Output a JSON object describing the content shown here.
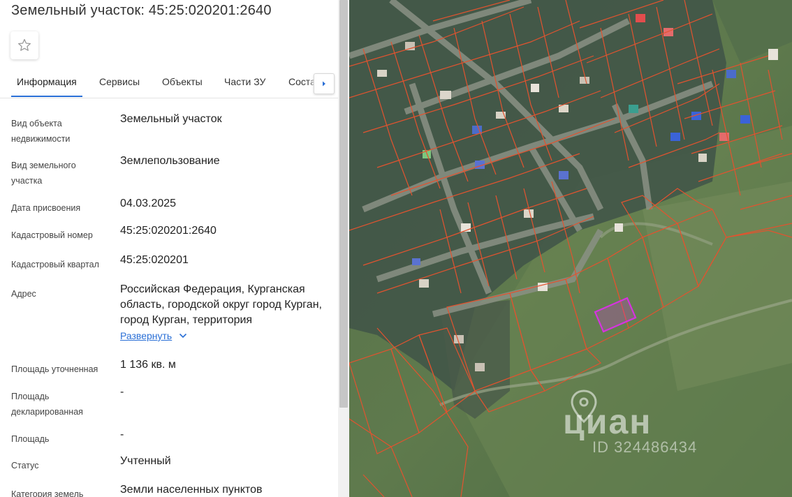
{
  "header": {
    "title": "Земельный участок: 45:25:020201:2640"
  },
  "tabs": [
    {
      "label": "Информация"
    },
    {
      "label": "Сервисы"
    },
    {
      "label": "Объекты"
    },
    {
      "label": "Части ЗУ"
    },
    {
      "label": "Состав"
    }
  ],
  "info": {
    "object_type": {
      "label": "Вид объекта недвижимости",
      "value": "Земельный участок"
    },
    "parcel_type": {
      "label": "Вид земельного участка",
      "value": "Землепользование"
    },
    "assign_date": {
      "label": "Дата присвоения",
      "value": "04.03.2025"
    },
    "cadastral_number": {
      "label": "Кадастровый номер",
      "value": "45:25:020201:2640"
    },
    "cadastral_quarter": {
      "label": "Кадастровый квартал",
      "value": "45:25:020201"
    },
    "address": {
      "label": "Адрес",
      "value": "Российская Федерация, Курганская область, городской округ город Курган, город Курган, территория",
      "expand_label": "Развернуть"
    },
    "area_specified": {
      "label": "Площадь уточненная",
      "value": "1 136 кв. м"
    },
    "area_declared": {
      "label": "Площадь декларированная",
      "value": "-"
    },
    "area": {
      "label": "Площадь",
      "value": "-"
    },
    "status": {
      "label": "Статус",
      "value": "Учтенный"
    },
    "land_category": {
      "label": "Категория земель",
      "value": "Земли населенных пунктов"
    }
  },
  "map": {
    "watermark": "циан",
    "watermark_id": "ID 324486434",
    "colors": {
      "boundary": "#e2532f",
      "selected": "#d633e0",
      "vegetation": "#4f6f45"
    }
  }
}
